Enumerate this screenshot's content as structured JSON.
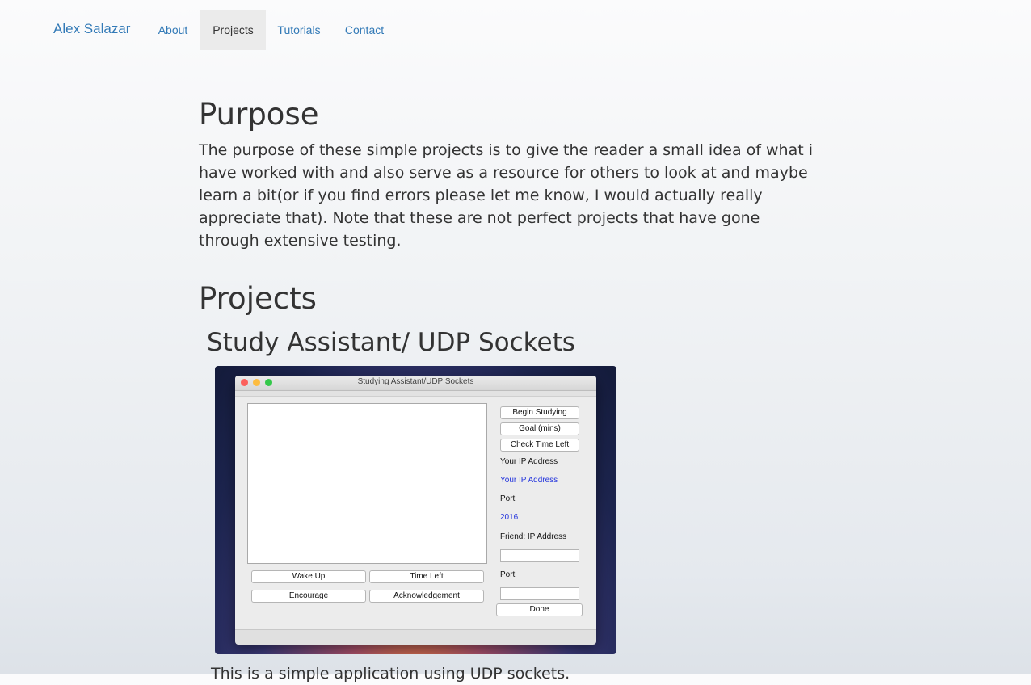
{
  "navbar": {
    "brand": "Alex Salazar",
    "items": [
      {
        "label": "About",
        "active": false
      },
      {
        "label": "Projects",
        "active": true
      },
      {
        "label": "Tutorials",
        "active": false
      },
      {
        "label": "Contact",
        "active": false
      }
    ]
  },
  "purpose": {
    "heading": "Purpose",
    "text": "The purpose of these simple projects is to give the reader a small idea of what i have worked with and also serve as a resource for others to look at and maybe learn a bit(or if you find errors please let me know, I would actually really appreciate that). Note that these are not perfect projects that have gone through extensive testing."
  },
  "projects": {
    "heading": "Projects",
    "items": [
      {
        "title": "Study Assistant/ UDP Sockets",
        "caption": "This is a simple application using UDP sockets.",
        "screenshot": {
          "window_title": "Studying Assistant/UDP Sockets",
          "buttons": {
            "begin_studying": "Begin Studying",
            "goal": "Goal (mins)",
            "check_time_left": "Check Time Left",
            "wake_up": "Wake Up",
            "time_left": "Time Left",
            "encourage": "Encourage",
            "acknowledgement": "Acknowledgement",
            "done": "Done"
          },
          "labels": {
            "your_ip_label": "Your IP Address",
            "your_ip_value": "Your IP Address",
            "port_label": "Port",
            "port_value": "2016",
            "friend_ip_label": "Friend: IP Address",
            "friend_port_label": "Port"
          },
          "colors": {
            "close": "#fc605c",
            "minimize": "#fdbc40",
            "zoom": "#34c84a",
            "value_blue": "#2233dd"
          }
        }
      }
    ]
  }
}
